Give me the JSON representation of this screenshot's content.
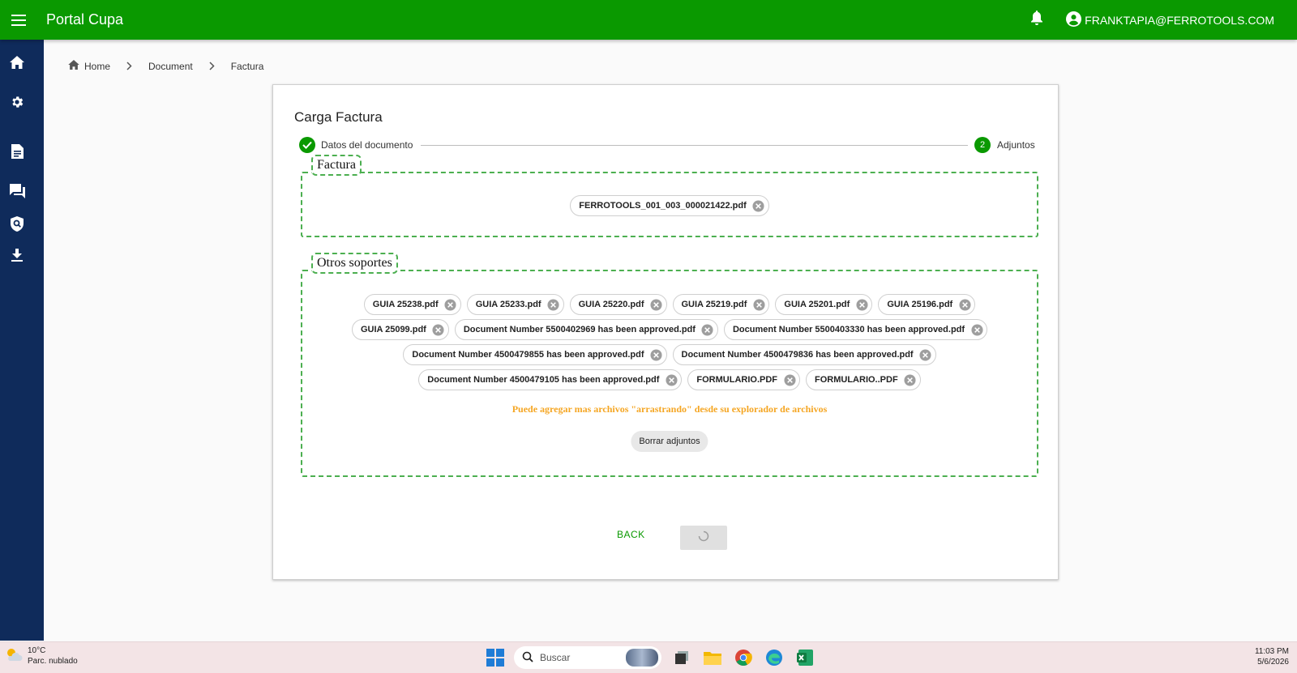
{
  "topbar": {
    "title": "Portal Cupa",
    "user": "FRANKTAPIA@FERROTOOLS.COM"
  },
  "sidebar": {
    "icons": [
      "home-icon",
      "settings-icon",
      "document-icon",
      "chat-icon",
      "search-shield-icon",
      "download-icon"
    ]
  },
  "breadcrumb": {
    "home": "Home",
    "document": "Document",
    "current": "Factura"
  },
  "card": {
    "title": "Carga Factura",
    "steps": {
      "step1_label": "Datos del documento",
      "step2_number": "2",
      "step2_label": "Adjuntos"
    },
    "factura": {
      "legend": "Factura",
      "files": [
        "FERROTOOLS_001_003_000021422.pdf"
      ]
    },
    "otros": {
      "legend": "Otros soportes",
      "rows": [
        [
          "GUIA 25238.pdf",
          "GUIA 25233.pdf",
          "GUIA 25220.pdf",
          "GUIA 25219.pdf",
          "GUIA 25201.pdf",
          "GUIA 25196.pdf"
        ],
        [
          "GUIA 25099.pdf",
          "Document Number 5500402969 has been approved.pdf",
          "Document Number 5500403330 has been approved.pdf"
        ],
        [
          "Document Number 4500479855 has been approved.pdf",
          "Document Number 4500479836 has been approved.pdf"
        ],
        [
          "Document Number 4500479105 has been approved.pdf",
          "FORMULARIO.PDF",
          "FORMULARIO..PDF"
        ]
      ],
      "hint": "Puede agregar mas archivos \"arrastrando\" desde su explorador de archivos",
      "clear_label": "Borrar adjuntos"
    },
    "back_label": "BACK"
  },
  "taskbar": {
    "temperature": "10°C",
    "weather": "Parc. nublado",
    "search_placeholder": "Buscar",
    "time": "11:03 PM",
    "date": "5/6/2026"
  },
  "colors": {
    "primary_green": "#0a9900",
    "sidebar_navy": "#0f2b5b",
    "dashed_border": "#4caf50",
    "hint_orange": "#f5a623"
  }
}
